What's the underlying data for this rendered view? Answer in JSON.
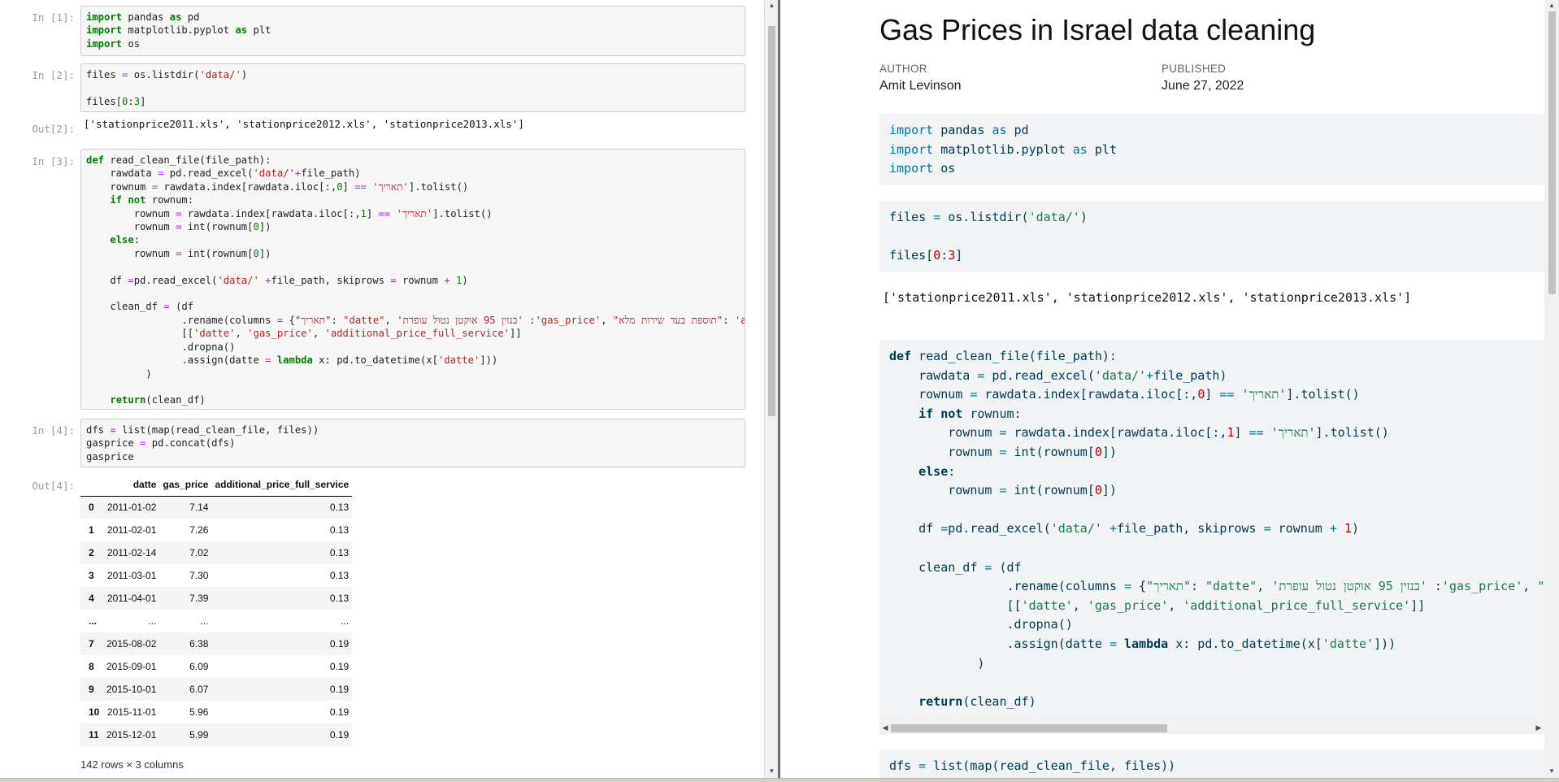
{
  "notebook": {
    "cells": [
      {
        "prompt": "In [1]:"
      },
      {
        "prompt": "In [2]:",
        "out_prompt": "Out[2]:",
        "output": "['stationprice2011.xls', 'stationprice2012.xls', 'stationprice2013.xls']"
      },
      {
        "prompt": "In [3]:"
      },
      {
        "prompt": "In [4]:",
        "out_prompt": "Out[4]:"
      }
    ],
    "dataframe": {
      "columns": [
        "",
        "datte",
        "gas_price",
        "additional_price_full_service"
      ],
      "rows": [
        [
          "0",
          "2011-01-02",
          "7.14",
          "0.13"
        ],
        [
          "1",
          "2011-02-01",
          "7.26",
          "0.13"
        ],
        [
          "2",
          "2011-02-14",
          "7.02",
          "0.13"
        ],
        [
          "3",
          "2011-03-01",
          "7.30",
          "0.13"
        ],
        [
          "4",
          "2011-04-01",
          "7.39",
          "0.13"
        ],
        [
          "...",
          "...",
          "...",
          "..."
        ],
        [
          "7",
          "2015-08-02",
          "6.38",
          "0.19"
        ],
        [
          "8",
          "2015-09-01",
          "6.09",
          "0.19"
        ],
        [
          "9",
          "2015-10-01",
          "6.07",
          "0.19"
        ],
        [
          "10",
          "2015-11-01",
          "5.96",
          "0.19"
        ],
        [
          "11",
          "2015-12-01",
          "5.99",
          "0.19"
        ]
      ],
      "shape": "142 rows × 3 columns"
    }
  },
  "document": {
    "title": "Gas Prices in Israel data cleaning",
    "author_label": "AUTHOR",
    "author": "Amit Levinson",
    "published_label": "PUBLISHED",
    "published": "June 27, 2022",
    "output_files": "['stationprice2011.xls', 'stationprice2012.xls', 'stationprice2013.xls']"
  },
  "code_text": {
    "c1": "import pandas as pd\nimport matplotlib.pyplot as plt\nimport os",
    "c2": "files = os.listdir('data/')\n\nfiles[0:3]",
    "c4": "dfs = list(map(read_clean_file, files))\ngasprice = pd.concat(dfs)\ngasprice",
    "d_last": "dfs = list(map(read_clean_file, files))"
  },
  "colors": {
    "notebook_keyword": "#008000",
    "notebook_string": "#ba2121",
    "doc_code_bg": "#f1f3f5",
    "doc_string": "#20794d"
  }
}
